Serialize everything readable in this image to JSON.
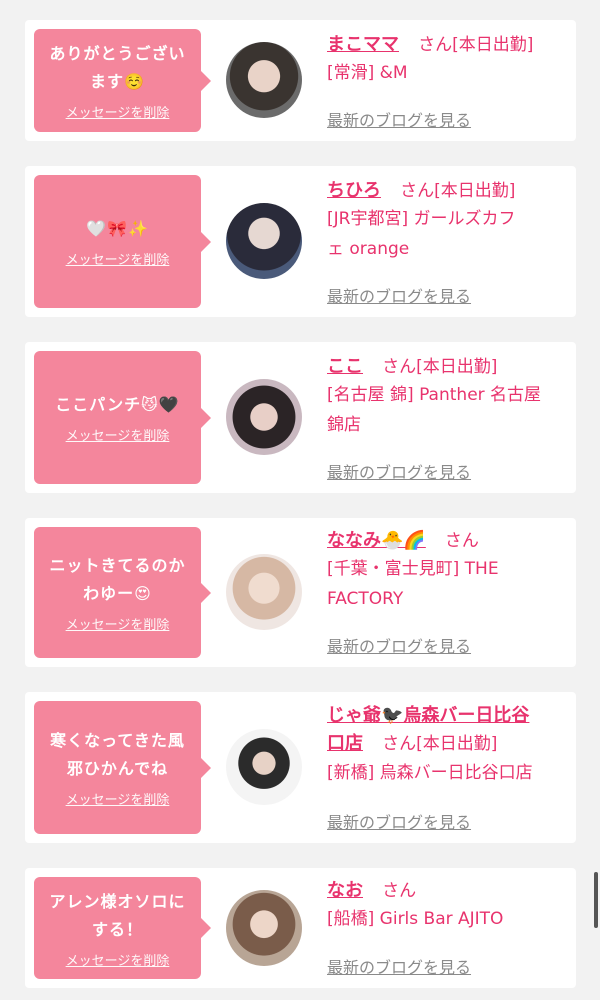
{
  "delete_label": "メッセージを削除",
  "blog_label": "最新のブログを見る",
  "cards": [
    {
      "message_l1": "ありがとうござい",
      "message_l2": "ます☺️",
      "name": "まこママ",
      "san": "さん",
      "status": "[本日出勤]",
      "shop_l1": "[常滑] &M",
      "shop_l2": ""
    },
    {
      "message_l1": "🤍🎀✨",
      "message_l2": "",
      "name": "ちひろ",
      "san": "さん",
      "status": "[本日出勤]",
      "shop_l1": "[JR宇都宮] ガールズカフ",
      "shop_l2": "ェ orange"
    },
    {
      "message_l1": "ここパンチ😼🖤",
      "message_l2": "",
      "name": "ここ",
      "san": "さん",
      "status": "[本日出勤]",
      "shop_l1": "[名古屋 錦] Panther 名古屋",
      "shop_l2": "錦店"
    },
    {
      "message_l1": "ニットきてるのか",
      "message_l2": "わゆー😍",
      "name": "ななみ🐣🌈",
      "san": "さん",
      "status": "",
      "shop_l1": "[千葉・富士見町] THE",
      "shop_l2": "FACTORY"
    },
    {
      "message_l1": "寒くなってきた風",
      "message_l2": "邪ひかんでね",
      "name_l1": "じゃ爺🐦‍⬛烏森バー日比谷",
      "name_l2": "口店",
      "san": "さん",
      "status": "[本日出勤]",
      "shop_l1": "[新橋] 烏森バー日比谷口店",
      "shop_l2": ""
    },
    {
      "message_l1": "アレン様オソロに",
      "message_l2": "する！",
      "name": "なお",
      "san": "さん",
      "status": "",
      "shop_l1": "[船橋] Girls Bar AJITO",
      "shop_l2": ""
    }
  ]
}
